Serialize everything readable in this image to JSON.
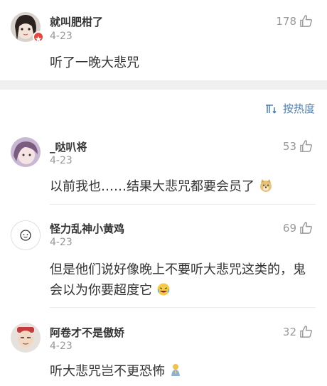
{
  "top_comment": {
    "username": "就叫肥柑了",
    "date": "4-23",
    "likes": "178",
    "text": "听了一晚大悲咒"
  },
  "sort": {
    "label": "按热度",
    "icon": "sort-icon"
  },
  "comments": [
    {
      "username": "_哒叭将",
      "date": "4-23",
      "likes": "53",
      "text": "以前我也……结果大悲咒都要会员了"
    },
    {
      "username": "怪力乱神小黄鸡",
      "date": "4-23",
      "likes": "69",
      "text": "但是他们说好像晚上不要听大悲咒这类的，鬼会以为你要超度它"
    },
    {
      "username": "阿卷才不是傲娇",
      "date": "4-23",
      "likes": "32",
      "text": "听大悲咒岂不更恐怖"
    }
  ],
  "icons": {
    "like": "thumbs-up-icon"
  },
  "colors": {
    "link_blue": "#4d7fb5",
    "meta_gray": "#999999",
    "badge_red": "#e8453c"
  }
}
